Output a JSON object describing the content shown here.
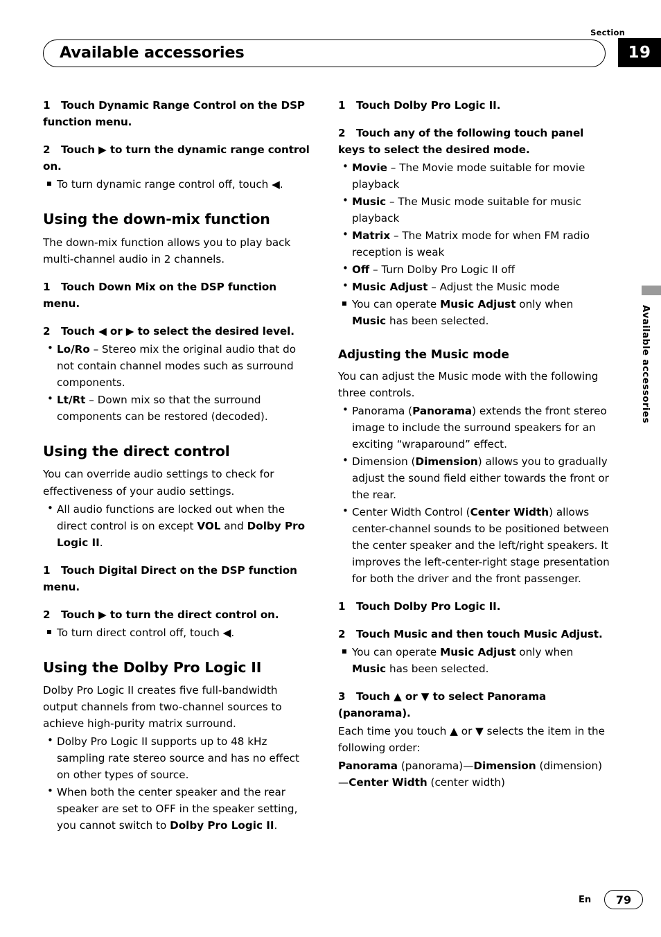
{
  "header": {
    "section_label": "Section",
    "section_number": "19",
    "title": "Available accessories"
  },
  "side_tab": {
    "text": "Available accessories"
  },
  "footer": {
    "language": "En",
    "page_number": "79"
  },
  "left_column": {
    "step1": {
      "num": "1",
      "text": "Touch Dynamic Range Control on the DSP function menu."
    },
    "step2": {
      "num": "2",
      "text_a": "Touch ",
      "arrow": "▶",
      "text_b": " to turn the dynamic range control on."
    },
    "note1_a": "To turn dynamic range control off, touch ",
    "note1_arrow": "◀",
    "note1_b": ".",
    "h_downmix": "Using the down-mix function",
    "downmix_intro": "The down-mix function allows you to play back multi-channel audio in 2 channels.",
    "dm_step1": {
      "num": "1",
      "text": "Touch Down Mix on the DSP function menu."
    },
    "dm_step2": {
      "num": "2",
      "text_a": "Touch ",
      "arrow_l": "◀",
      "text_b": " or ",
      "arrow_r": "▶",
      "text_c": " to select the desired level."
    },
    "dm_b1_term": "Lo/Ro",
    "dm_b1_text": " – Stereo mix the original audio that do not contain channel modes such as surround components.",
    "dm_b2_term": "Lt/Rt",
    "dm_b2_text": " – Down mix so that the surround components can be restored (decoded).",
    "h_direct": "Using the direct control",
    "direct_intro": "You can override audio settings to check for effectiveness of your audio settings.",
    "direct_b1_a": "All audio functions are locked out when the direct control is on except ",
    "direct_b1_vol": "VOL",
    "direct_b1_b": " and ",
    "direct_b1_dpl": "Dolby Pro Logic II",
    "direct_b1_c": ".",
    "dc_step1": {
      "num": "1",
      "text": "Touch Digital Direct on the DSP function menu."
    },
    "dc_step2": {
      "num": "2",
      "text_a": "Touch ",
      "arrow": "▶",
      "text_b": " to turn the direct control on."
    },
    "dc_note_a": "To turn direct control off, touch ",
    "dc_note_arrow": "◀",
    "dc_note_b": ".",
    "h_dolby": "Using the Dolby Pro Logic II",
    "dolby_intro": "Dolby Pro Logic II creates five full-bandwidth output channels from two-channel sources to achieve high-purity matrix surround.",
    "dolby_b1": "Dolby Pro Logic II supports up to 48 kHz sampling rate stereo source and has no effect on other types of source.",
    "dolby_b2_a": "When both the center speaker and the rear speaker are set to OFF in the speaker setting, you cannot switch to ",
    "dolby_b2_bold": "Dolby Pro Logic II",
    "dolby_b2_b": "."
  },
  "right_column": {
    "r_step1": {
      "num": "1",
      "text": "Touch Dolby Pro Logic II."
    },
    "r_step2": {
      "num": "2",
      "text": "Touch any of the following touch panel keys to select the desired mode."
    },
    "mode_movie_term": "Movie",
    "mode_movie_text": " – The Movie mode suitable for movie playback",
    "mode_music_term": "Music",
    "mode_music_text": " – The Music mode suitable for music playback",
    "mode_matrix_term": "Matrix",
    "mode_matrix_text": " – The Matrix mode for when FM radio reception is weak",
    "mode_off_term": "Off",
    "mode_off_text": " – Turn Dolby Pro Logic II off",
    "mode_adjust_term": "Music Adjust",
    "mode_adjust_text": " – Adjust the Music mode",
    "note_a": "You can operate ",
    "note_b": "Music Adjust",
    "note_c": " only when ",
    "note_d": "Music",
    "note_e": " has been selected.",
    "h_adjust": "Adjusting the Music mode",
    "adjust_intro": "You can adjust the Music mode with the following three controls.",
    "adj_b1_a": "Panorama (",
    "adj_b1_bold": "Panorama",
    "adj_b1_b": ") extends the front stereo image to include the surround speakers for an exciting “wraparound” effect.",
    "adj_b2_a": "Dimension (",
    "adj_b2_bold": "Dimension",
    "adj_b2_b": ") allows you to gradually adjust the sound field either towards the front or the rear.",
    "adj_b3_a": "Center Width Control (",
    "adj_b3_bold": "Center Width",
    "adj_b3_b": ") allows center-channel sounds to be positioned between the center speaker and the left/right speakers. It improves the left-center-right stage presentation for both the driver and the front passenger.",
    "a_step1": {
      "num": "1",
      "text": "Touch Dolby Pro Logic II."
    },
    "a_step2": {
      "num": "2",
      "text": "Touch Music and then touch Music Adjust."
    },
    "a_note_a": "You can operate ",
    "a_note_b": "Music Adjust",
    "a_note_c": " only when ",
    "a_note_d": "Music",
    "a_note_e": " has been selected.",
    "a_step3": {
      "num": "3",
      "text_a": "Touch ",
      "arrow_u": "▲",
      "text_b": " or ",
      "arrow_d": "▼",
      "text_c": " to select Panorama (panorama)."
    },
    "each_a": "Each time you touch ",
    "each_up": "▲",
    "each_b": " or ",
    "each_down": "▼",
    "each_c": " selects the item in the following order:",
    "order_1": "Panorama",
    "order_1b": " (panorama)—",
    "order_2": "Dimension",
    "order_2b": " (dimension)—",
    "order_3": "Center Width",
    "order_3b": " (center width)"
  }
}
